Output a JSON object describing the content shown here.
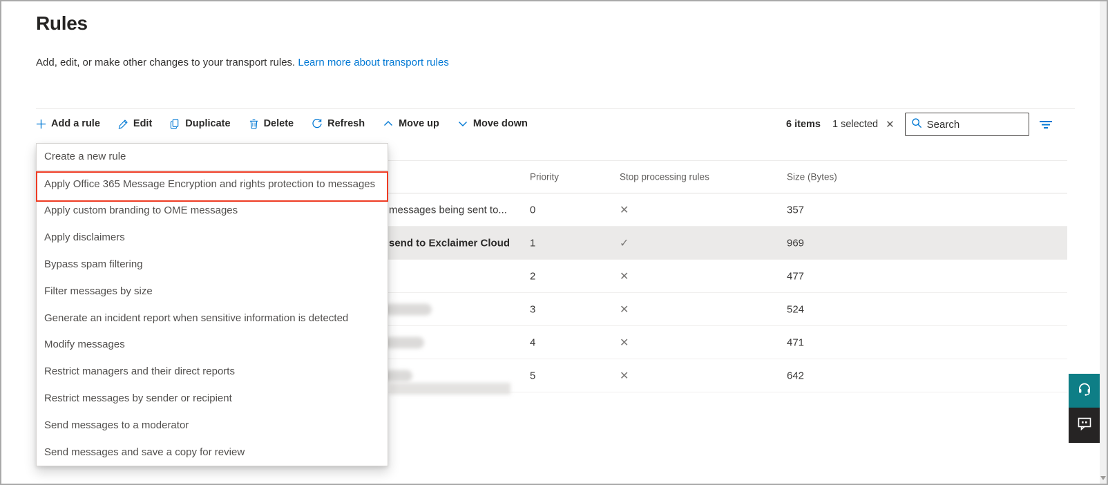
{
  "page": {
    "title": "Rules",
    "description": "Add, edit, or make other changes to your transport rules.",
    "description_link": "Learn more about transport rules"
  },
  "toolbar": {
    "buttons": [
      {
        "label": "Add a rule",
        "icon": "plus-icon"
      },
      {
        "label": "Edit",
        "icon": "pencil-icon"
      },
      {
        "label": "Duplicate",
        "icon": "copy-icon"
      },
      {
        "label": "Delete",
        "icon": "trash-icon"
      },
      {
        "label": "Refresh",
        "icon": "refresh-icon"
      },
      {
        "label": "Move up",
        "icon": "chevron-up-icon"
      },
      {
        "label": "Move down",
        "icon": "chevron-down-icon"
      }
    ],
    "items_count": "6 items",
    "selected_count": "1 selected",
    "clear_glyph": "✕",
    "search_placeholder": "Search"
  },
  "template_menu": {
    "items": [
      "Create a new rule",
      "Apply Office 365 Message Encryption and rights protection to messages",
      "Apply custom branding to OME messages",
      "Apply disclaimers",
      "Bypass spam filtering",
      "Filter messages by size",
      "Generate an incident report when sensitive information is detected",
      "Modify messages",
      "Restrict managers and their direct reports",
      "Restrict messages by sender or recipient",
      "Send messages to a moderator",
      "Send messages and save a copy for review"
    ],
    "highlighted_item": "Apply Office 365 Message Encryption and rights protection to messages",
    "highlight_color": "#ee3b23"
  },
  "table": {
    "columns": [
      "Priority",
      "Stop processing rules",
      "Size (Bytes)"
    ],
    "rows": [
      {
        "name_fragment": "messages being sent to...",
        "priority": "0",
        "stop_processing": "no",
        "stop_glyph": "✕",
        "size": "357",
        "selected": false,
        "redacted": false
      },
      {
        "name_fragment": "send to Exclaimer Cloud",
        "priority": "1",
        "stop_processing": "yes",
        "stop_glyph": "✓",
        "size": "969",
        "selected": true,
        "redacted": false
      },
      {
        "name_fragment": "",
        "priority": "2",
        "stop_processing": "no",
        "stop_glyph": "✕",
        "size": "477",
        "selected": false,
        "redacted": true
      },
      {
        "name_fragment": "",
        "priority": "3",
        "stop_processing": "no",
        "stop_glyph": "✕",
        "size": "524",
        "selected": false,
        "redacted": true
      },
      {
        "name_fragment": "",
        "priority": "4",
        "stop_processing": "no",
        "stop_glyph": "✕",
        "size": "471",
        "selected": false,
        "redacted": true
      },
      {
        "name_fragment": "",
        "priority": "5",
        "stop_processing": "no",
        "stop_glyph": "✕",
        "size": "642",
        "selected": false,
        "redacted": true
      }
    ]
  },
  "colors": {
    "accent": "#0078d4",
    "highlight_red": "#ee3b23",
    "selected_row_bg": "#ebeae9",
    "help_button": "#0e7e86",
    "feedback_button": "#262424"
  }
}
